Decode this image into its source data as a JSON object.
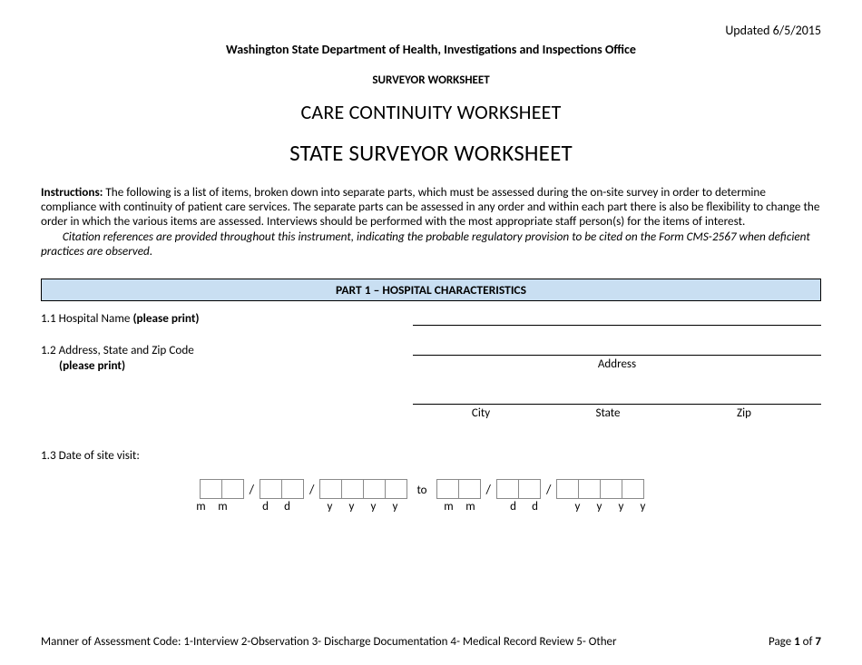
{
  "header": {
    "updated": "Updated 6/5/2015",
    "department": "Washington State Department of Health, Investigations and Inspections Office",
    "surveyor_worksheet": "SURVEYOR WORKSHEET",
    "care_continuity": "CARE CONTINUITY WORKSHEET",
    "state_surveyor": "STATE SURVEYOR WORKSHEET"
  },
  "instructions": {
    "label": "Instructions:",
    "body": " The following is a list of items, broken down into separate parts, which must be assessed during the on-site survey in order to determine compliance with continuity of patient care services.  The separate parts can be assessed in any order and within each part there is also be flexibility to change the order in which the various items are assessed. Interviews should be performed with the most appropriate staff person(s) for the items of interest.",
    "citation_indent": "        ",
    "citation": "Citation references are provided throughout this instrument, indicating the probable regulatory provision to be cited on the Form CMS-2567 when deficient practices are observed."
  },
  "part1": {
    "title": "PART 1 – HOSPITAL CHARACTERISTICS"
  },
  "fields": {
    "f11_num": "1.1 Hospital Name ",
    "f11_bold": "(please print)",
    "f12_num": "1.2 Address, State and Zip Code",
    "f12_bold": "(please print)",
    "address_label": "Address",
    "city_label": "City",
    "state_label": "State",
    "zip_label": "Zip",
    "f13_num": "1.3  Date of site visit:"
  },
  "date": {
    "slash": "/",
    "to": "to",
    "m": "m",
    "d": "d",
    "y": "y"
  },
  "footer": {
    "assessment": "Manner of Assessment Code:  1-Interview   2-Observation   3- Discharge Documentation   4- Medical Record Review   5- Other",
    "page_prefix": "Page ",
    "page_current": "1",
    "page_of": " of ",
    "page_total": "7"
  }
}
